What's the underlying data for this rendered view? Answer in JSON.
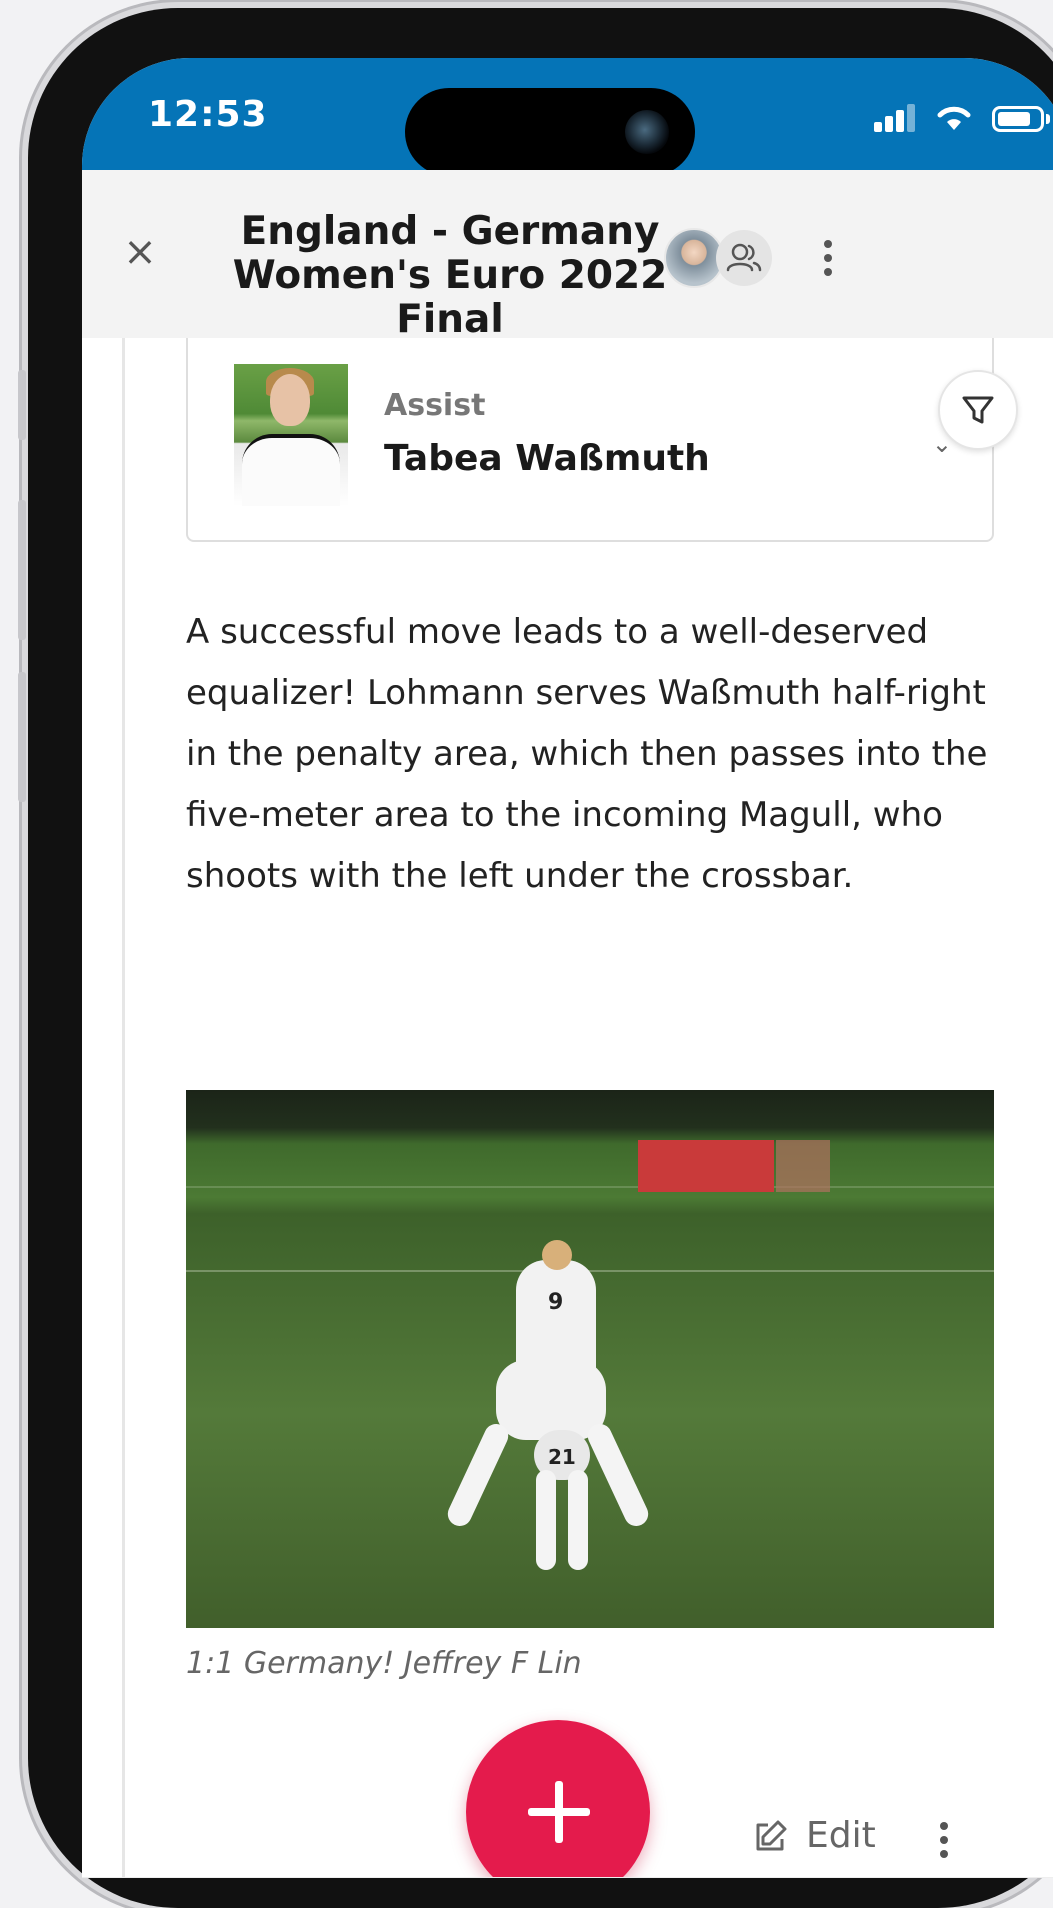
{
  "status_bar": {
    "time": "12:53"
  },
  "header": {
    "title_line1": "England - Germany",
    "title_line2": "Women's Euro 2022 Final",
    "close_symbol": "×"
  },
  "assist_card": {
    "label": "Assist",
    "player_name": "Tabea Waßmuth",
    "chevron": "⌄"
  },
  "post": {
    "text": "A successful move leads to a well-deserved equalizer! Lohmann serves Waßmuth half-right in the penalty area, which then passes into the five-meter area to the incoming Magull, who shoots with the left under the crossbar.",
    "image_caption": "1:1 Germany! Jeffrey F Lin",
    "image_jersey_numbers": [
      "9",
      "21"
    ]
  },
  "footer": {
    "edit_label": "Edit"
  },
  "colors": {
    "status_bar": "#0574b7",
    "fab": "#e41b4c"
  },
  "icons": [
    "close-icon",
    "avatar",
    "people-icon",
    "more-vertical-icon",
    "filter-icon",
    "chevron-down-icon",
    "plus-icon",
    "edit-icon"
  ]
}
